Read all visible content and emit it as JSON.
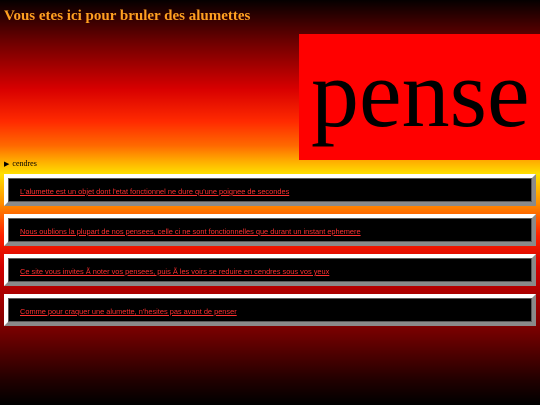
{
  "header": {
    "title": "Vous etes ici pour bruler des alumettes"
  },
  "banner": {
    "text": "pense"
  },
  "details": {
    "marker": "▶",
    "label": "cendres"
  },
  "cards": [
    {
      "link": "L'alumette est un objet dont l'etat fonctionnel ne dure qu'une poignee de secondes"
    },
    {
      "link": "Nous oublions la plupart de nos pensees, celle ci ne sont fonctionnelles que durant un instant ephemere"
    },
    {
      "link": "Ce site vous invites Ã  noter vos pensees, puis Ã  les voirs se reduire en cendres sous vos yeux"
    },
    {
      "link": "Comme pour craquer une alumette, n'hesites pas avant de penser"
    }
  ],
  "colors": {
    "title": "#ffa020",
    "banner_bg": "#ff0000",
    "link": "#ff3030",
    "card_bg": "#000000"
  }
}
